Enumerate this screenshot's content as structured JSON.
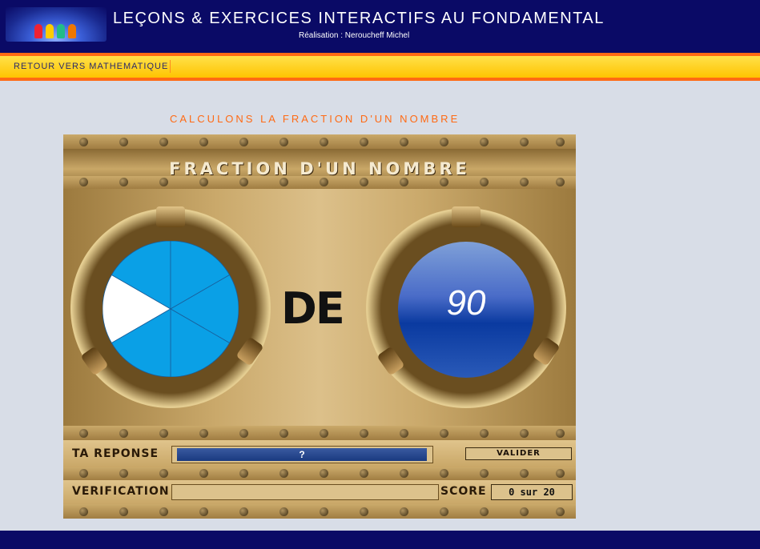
{
  "header": {
    "title": "LEÇONS & EXERCICES INTERACTIFS AU FONDAMENTAL",
    "subtitle": "Réalisation : Neroucheff Michel"
  },
  "nav": {
    "back_link": "RETOUR VERS MATHEMATIQUE"
  },
  "page": {
    "heading": "CALCULONS LA FRACTION D'UN NOMBRE"
  },
  "game": {
    "title": "FRACTION D'UN NOMBRE",
    "pie_total_parts": 6,
    "pie_shaded_parts": 1,
    "connector": "DE",
    "number": "90",
    "answer_label": "TA REPONSE",
    "answer_value": "?",
    "validate_label": "VALIDER",
    "verification_label": "VERIFICATION",
    "verification_value": "",
    "score_label": "SCORE",
    "score_value": "0 sur 20"
  },
  "colors": {
    "header_bg": "#0a0a66",
    "nav_bar": "#ffd21a",
    "accent": "#ff6a14",
    "pie_fill": "#0aa0e6",
    "pie_shaded": "#ffffff"
  }
}
